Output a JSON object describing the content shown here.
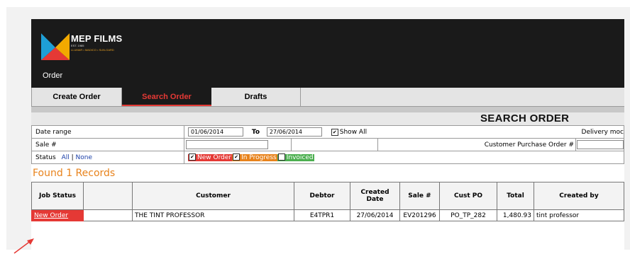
{
  "header": {
    "logo_title": "MEP FILMS",
    "logo_est": "EST. 1985",
    "logo_brands": "LLUMAR • MADICO • SUN-GARD",
    "nav_label": "Order"
  },
  "tabs": [
    {
      "label": "Create Order"
    },
    {
      "label": "Search Order"
    },
    {
      "label": "Drafts"
    }
  ],
  "search": {
    "title": "SEARCH ORDER",
    "date_range_label": "Date range",
    "date_from": "01/06/2014",
    "to_label": "To",
    "date_to": "27/06/2014",
    "show_all_label": "Show All",
    "delivery_label": "Delivery moc",
    "sale_label": "Sale #",
    "cpo_label": "Customer Purchase Order #",
    "status_label": "Status",
    "all_link": "All",
    "separator": "|",
    "none_link": "None",
    "status_new": "New Order",
    "status_in_progress": "In Progress",
    "status_invoiced": "Invoiced"
  },
  "results": {
    "found_text": "Found 1 Records",
    "columns": [
      "Job Status",
      "",
      "Customer",
      "Debtor",
      "Created Date",
      "Sale #",
      "Cust PO",
      "Total",
      "Created by"
    ],
    "rows": [
      {
        "job_status": "New Order",
        "blank": "",
        "customer": "THE TINT PROFESSOR",
        "debtor": "E4TPR1",
        "created_date": "27/06/2014",
        "sale": "EV201296",
        "cust_po": "PO_TP_282",
        "total": "1,480.93",
        "created_by": "tint professor"
      }
    ]
  },
  "colors": {
    "accent_red": "#e53935",
    "found_orange": "#e8831c",
    "status_new_bg": "#e53935",
    "status_progress_bg": "#e8831c",
    "status_invoiced_bg": "#4caf50",
    "link_blue": "#1a3fa8"
  }
}
